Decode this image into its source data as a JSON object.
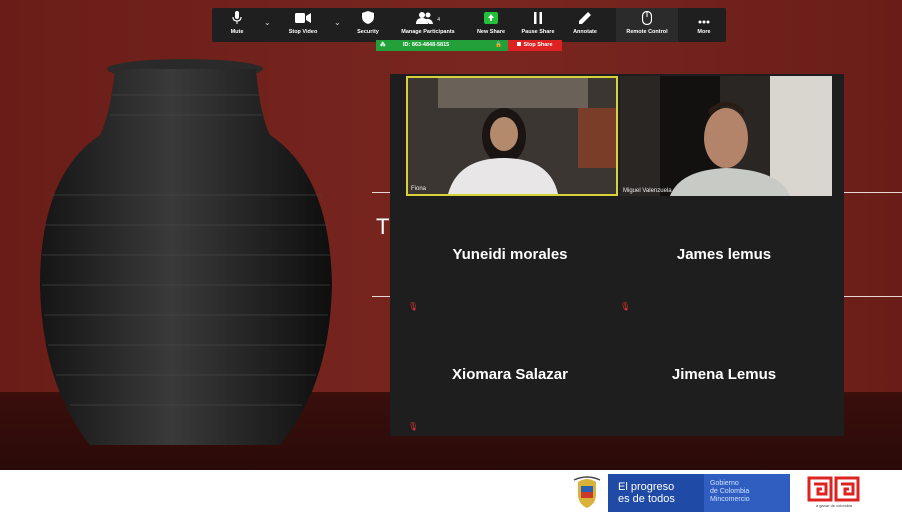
{
  "toolbar": {
    "buttons": [
      {
        "label": "Mute",
        "icon": "mic-icon"
      },
      {
        "label": "Stop Video",
        "icon": "video-camera-icon"
      },
      {
        "label": "Security",
        "icon": "shield-icon"
      },
      {
        "label": "Manage Participants",
        "icon": "participants-icon",
        "count": "4"
      },
      {
        "label": "New Share",
        "icon": "share-screen-icon"
      },
      {
        "label": "Pause Share",
        "icon": "pause-icon"
      },
      {
        "label": "Annotate",
        "icon": "pen-icon"
      },
      {
        "label": "Remote Control",
        "icon": "mouse-icon"
      },
      {
        "label": "More",
        "icon": "more-dots-icon"
      }
    ]
  },
  "share_bar": {
    "meeting_id": "ID: 863-4848-5815",
    "stop_share": "Stop Share",
    "accent_green": "#23a03a",
    "accent_red": "#dd2222"
  },
  "gallery": {
    "video_tiles": [
      {
        "name": "Fiona",
        "active_speaker": true
      },
      {
        "name": "Miguel Valenzuela",
        "active_speaker": false
      }
    ],
    "name_tiles": [
      {
        "name": "Yuneidi morales"
      },
      {
        "name": "James lemus"
      },
      {
        "name": "Xiomara Salazar"
      },
      {
        "name": "Jimena Lemus"
      }
    ]
  },
  "slide": {
    "letter": "T"
  },
  "footer": {
    "banner_line1": "El progreso",
    "banner_line2": "es de todos",
    "gov_line1": "Gobierno",
    "gov_line2": "de Colombia",
    "gov_line3": "Mincomercio",
    "logo_caption": "a ganar de colombia"
  }
}
